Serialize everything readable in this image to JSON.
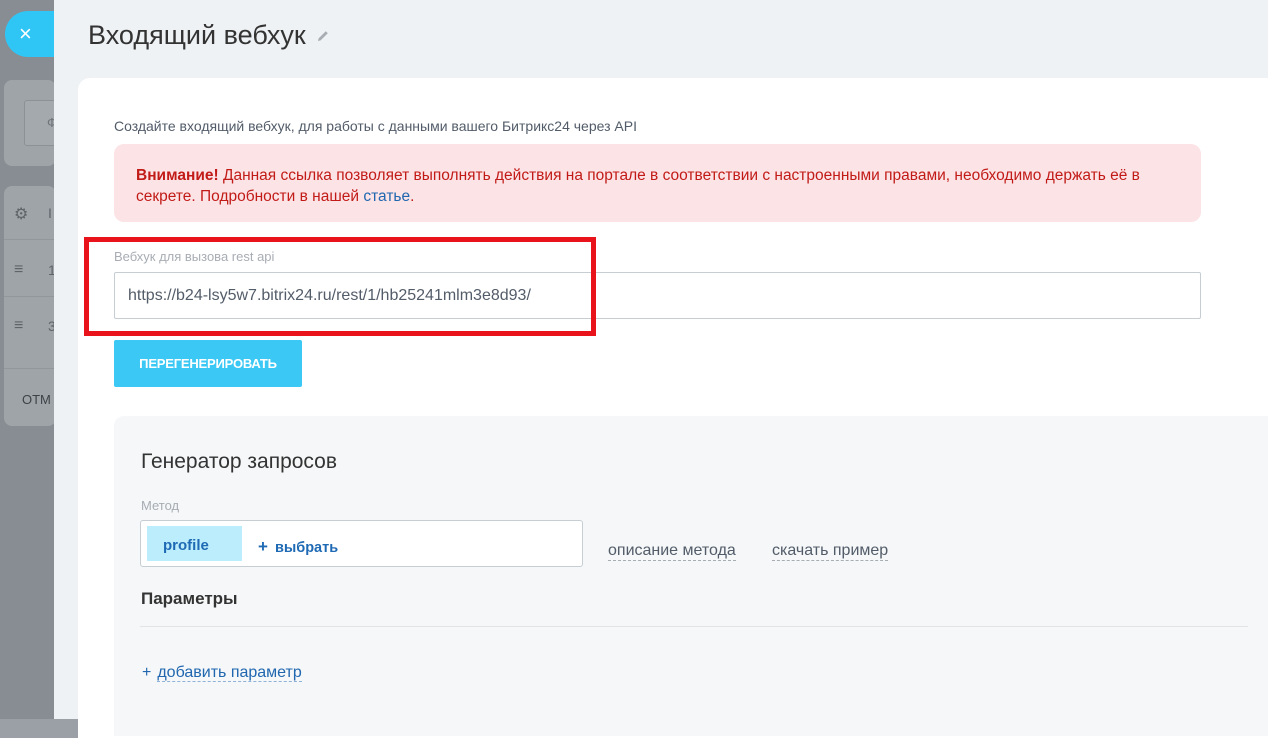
{
  "background": {
    "input_text": "Ф",
    "rows": [
      {
        "icon": "gear-icon",
        "text": "I"
      },
      {
        "icon": "menu-icon",
        "text": "1"
      },
      {
        "icon": "menu-icon",
        "text": "3"
      }
    ],
    "button_text": "ОТМ"
  },
  "header": {
    "title": "Входящий вебхук",
    "close_icon": "×"
  },
  "intro": "Создайте входящий вебхук, для работы с данными вашего Битрикс24 через API",
  "warning": {
    "bold": "Внимание!",
    "text": " Данная ссылка позволяет выполнять действия на портале в соответствии с настроенными правами, необходимо держать её в секрете. Подробности в нашей ",
    "link": "статье",
    "tail": "."
  },
  "webhook": {
    "label": "Вебхук для вызова rest api",
    "value": "https://b24-lsy5w7.bitrix24.ru/rest/1/hb25241mlm3e8d93/"
  },
  "regenerate_label": "ПЕРЕГЕНЕРИРОВАТЬ",
  "generator": {
    "title": "Генератор запросов",
    "method_label": "Метод",
    "method_value": "profile",
    "choose_plus": "+",
    "choose_label": "выбрать",
    "description_link": "описание метода",
    "download_link": "скачать пример",
    "params_title": "Параметры",
    "add_param_plus": "+",
    "add_param_label": "добавить параметр"
  },
  "colors": {
    "accent": "#3bc8f5",
    "warning_bg": "#fbe3e6",
    "warning_text": "#c21b17",
    "link": "#2067b0",
    "highlight_frame": "#e9141b"
  }
}
